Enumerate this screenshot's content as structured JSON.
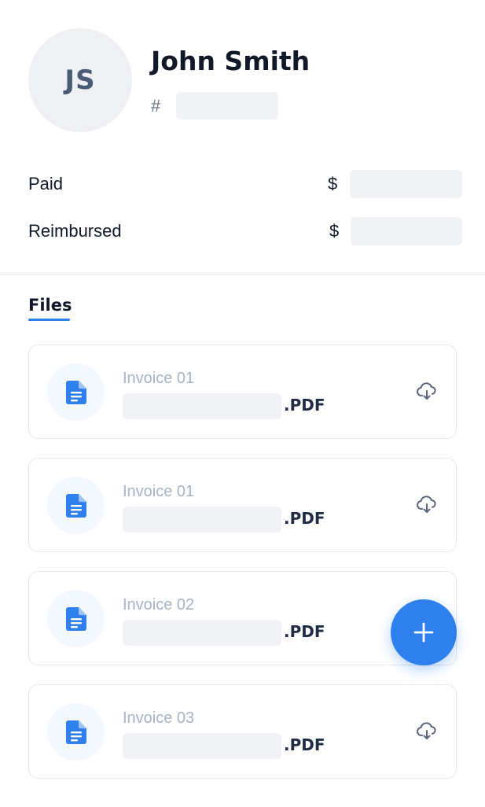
{
  "profile": {
    "initials": "JS",
    "name": "John Smith",
    "id_prefix": "#"
  },
  "amounts": [
    {
      "label": "Paid",
      "currency": "$"
    },
    {
      "label": "Reimbursed",
      "currency": "$"
    }
  ],
  "tabs": {
    "files": "Files"
  },
  "files": [
    {
      "title": "Invoice 01",
      "ext": ".PDF",
      "icon": "document-icon",
      "action_icon": "cloud-download-icon"
    },
    {
      "title": "Invoice 01",
      "ext": ".PDF",
      "icon": "document-icon",
      "action_icon": "cloud-download-icon"
    },
    {
      "title": "Invoice 02",
      "ext": ".PDF",
      "icon": "document-icon",
      "action_icon": "cloud-download-icon"
    },
    {
      "title": "Invoice 03",
      "ext": ".PDF",
      "icon": "document-icon",
      "action_icon": "cloud-download-icon"
    }
  ],
  "fab": {
    "icon": "plus-icon"
  },
  "colors": {
    "accent": "#2f80ed",
    "avatar_bg": "#eef0f4",
    "skeleton": "#f0f2f6",
    "muted_text": "#a8b1c4"
  }
}
